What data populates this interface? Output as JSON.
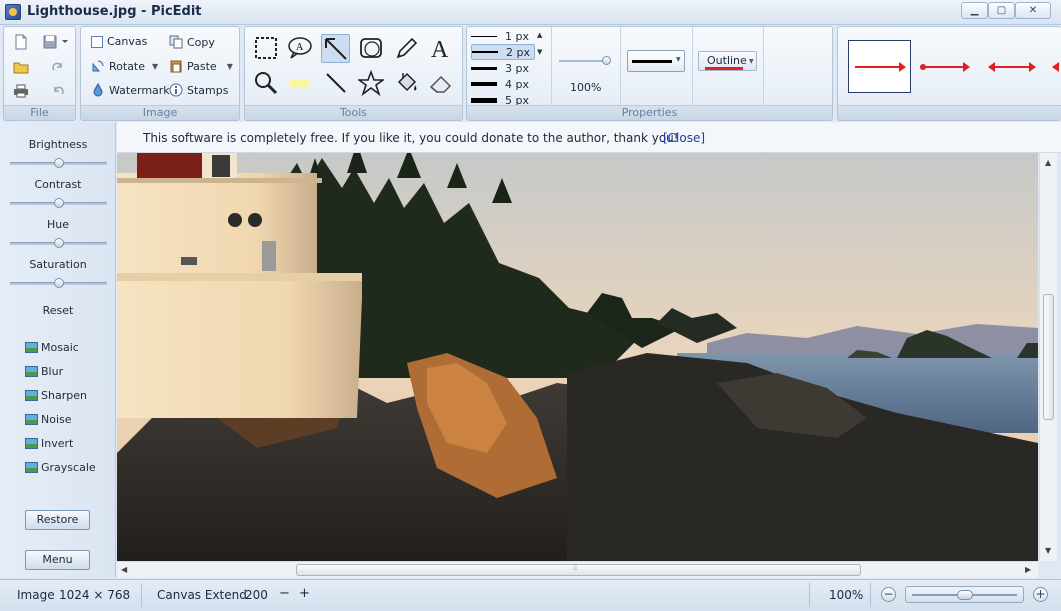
{
  "window": {
    "title": "Lighthouse.jpg - PicEdit",
    "minimize": "▁",
    "maximize": "▢",
    "close": "✕"
  },
  "ribbon": {
    "file": {
      "label": "File"
    },
    "image": {
      "label": "Image",
      "canvas": "Canvas",
      "rotate": "Rotate",
      "watermark": "Watermark",
      "copy": "Copy",
      "paste": "Paste",
      "stamps": "Stamps"
    },
    "tools": {
      "label": "Tools",
      "text_tool": "A"
    },
    "properties": {
      "label": "Properties",
      "sizes": [
        "1 px",
        "2 px",
        "3 px",
        "4 px",
        "5 px"
      ],
      "selected_size": "2 px",
      "opacity": "100%",
      "outline": "Outline"
    }
  },
  "left_panel": {
    "adjustments": [
      {
        "label": "Brightness",
        "level": 0.5
      },
      {
        "label": "Contrast",
        "level": 0.5
      },
      {
        "label": "Hue",
        "level": 0.5
      },
      {
        "label": "Saturation",
        "level": 0.5
      }
    ],
    "reset": "Reset",
    "effects": [
      "Mosaic",
      "Blur",
      "Sharpen",
      "Noise",
      "Invert",
      "Grayscale"
    ],
    "restore": "Restore",
    "menu": "Menu"
  },
  "notice": {
    "text": "This software is completely free. If you like it, you could donate to the author, thank you!",
    "close": "[Close]"
  },
  "status": {
    "image_label": "Image",
    "image_size": "1024 × 768",
    "canvas_extend_label": "Canvas Extend",
    "canvas_extend_value": "200",
    "minus": "−",
    "plus": "+",
    "zoom": "100%",
    "zoom_slider_level": 0.5
  },
  "colors": {
    "arrow": "#e02020",
    "ribbon_bg": "#e7eef7",
    "accent": "#1a3fa8"
  }
}
